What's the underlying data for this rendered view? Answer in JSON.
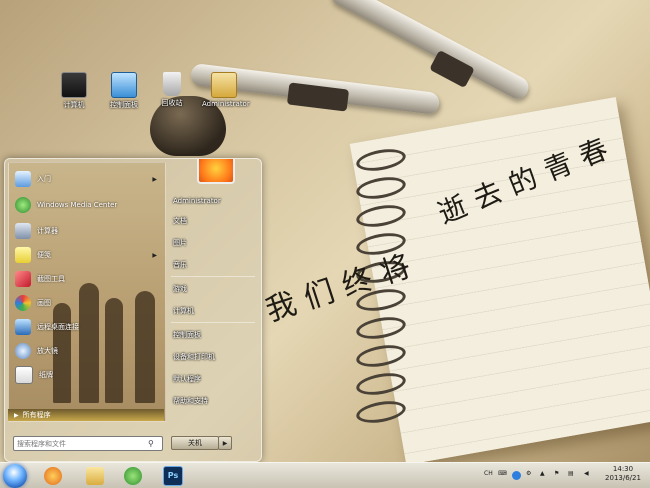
{
  "desktop": {
    "icons": [
      {
        "label": "计算机",
        "icon": "computer-icon"
      },
      {
        "label": "控制面板",
        "icon": "control-panel-icon"
      },
      {
        "label": "回收站",
        "icon": "recycle-bin-icon"
      },
      {
        "label": "Administrator",
        "icon": "user-folder-icon"
      }
    ],
    "wallpaper_text": [
      "逝去的青春",
      "我们终将"
    ]
  },
  "start_menu": {
    "left_items": [
      {
        "label": "入门",
        "icon": "getting-started-icon",
        "has_arrow": true
      },
      {
        "label": "Windows Media Center",
        "icon": "media-center-icon",
        "has_arrow": false
      },
      {
        "label": "计算器",
        "icon": "calculator-icon",
        "has_arrow": false
      },
      {
        "label": "便笺",
        "icon": "sticky-notes-icon",
        "has_arrow": true
      },
      {
        "label": "截图工具",
        "icon": "snipping-tool-icon",
        "has_arrow": false
      },
      {
        "label": "画图",
        "icon": "paint-icon",
        "has_arrow": false
      },
      {
        "label": "远程桌面连接",
        "icon": "remote-desktop-icon",
        "has_arrow": false
      },
      {
        "label": "放大镜",
        "icon": "magnifier-icon",
        "has_arrow": false
      },
      {
        "label": "纸牌",
        "icon": "solitaire-icon",
        "has_arrow": false
      }
    ],
    "all_programs": "所有程序",
    "search": {
      "placeholder": "搜索程序和文件"
    },
    "user_name": "Administrator",
    "right_items": [
      "文档",
      "图片",
      "音乐",
      "游戏",
      "计算机",
      "控制面板",
      "设备和打印机",
      "默认程序",
      "帮助和支持"
    ],
    "shutdown_label": "关机"
  },
  "taskbar": {
    "pinned": [
      {
        "name": "media-player",
        "icon": "media-player-icon"
      },
      {
        "name": "explorer",
        "icon": "folder-icon"
      },
      {
        "name": "internet-explorer",
        "icon": "ie-icon"
      },
      {
        "name": "photoshop",
        "icon": "photoshop-icon",
        "text": "Ps"
      }
    ],
    "tray": {
      "lang": "CH"
    },
    "clock": {
      "time": "14:30",
      "date": "2013/6/21"
    }
  },
  "colors": {
    "accent": "#1d5bb8",
    "wallpaper": "#d8c8a3",
    "ink": "#1e1a14"
  }
}
